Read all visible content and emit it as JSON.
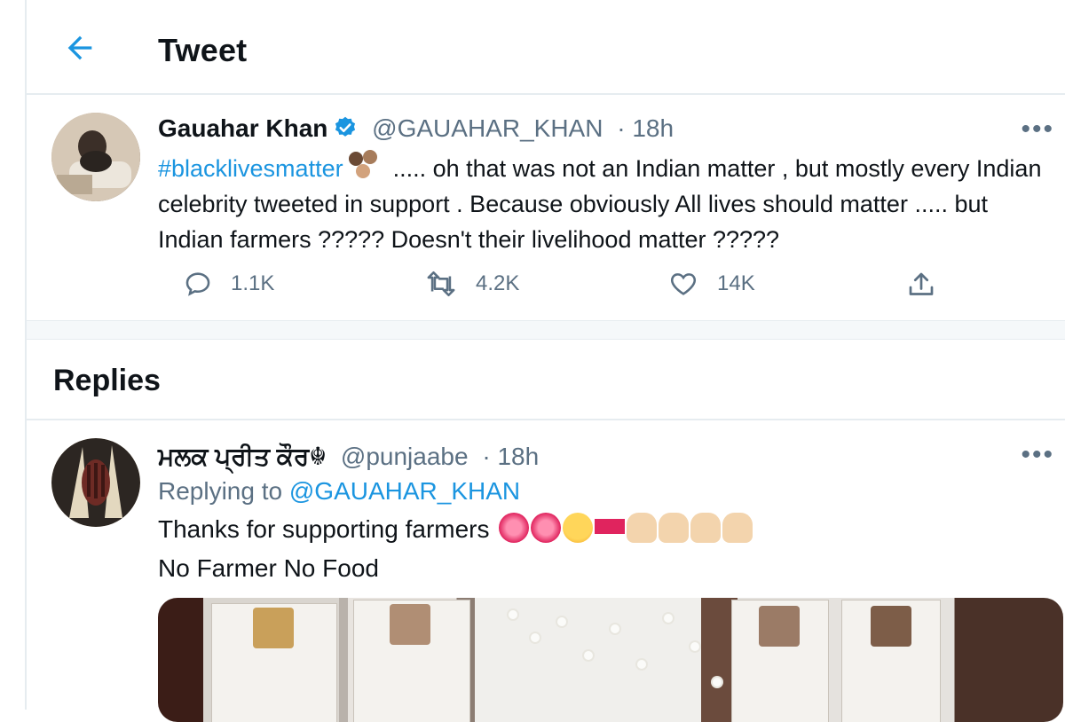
{
  "header": {
    "title": "Tweet"
  },
  "tweet": {
    "author_name": "Gauahar Khan",
    "author_handle": "@GAUAHAR_KHAN",
    "time": "· 18h",
    "hashtag": "#blacklivesmatter",
    "text": "..... oh that was not an Indian matter , but mostly every Indian celebrity tweeted in support . Because obviously All lives should matter ..... but Indian farmers ????? Doesn't their livelihood matter ?????",
    "replies_count": "1.1K",
    "retweets_count": "4.2K",
    "likes_count": "14K",
    "more_label": "•••"
  },
  "replies_section": {
    "title": "Replies"
  },
  "reply": {
    "author_name": "ਮਲਕ ਪ੍ਰੀਤ ਕੌਰ☬",
    "author_handle": "@punjaabe",
    "time": "· 18h",
    "replying_prefix": "Replying to",
    "replying_to": "@GAUAHAR_KHAN",
    "line1": "Thanks for supporting farmers",
    "line2": "No Farmer No Food",
    "more_label": "•••"
  },
  "colors": {
    "accent": "#1b95e0",
    "text": "#0f1419",
    "muted": "#5b7083",
    "border": "#e6ecf0"
  },
  "icons": {
    "back": "arrow-left-icon",
    "verified": "verified-badge-icon",
    "reply": "speech-bubble-icon",
    "retweet": "retweet-icon",
    "like": "heart-icon",
    "share": "share-icon"
  }
}
